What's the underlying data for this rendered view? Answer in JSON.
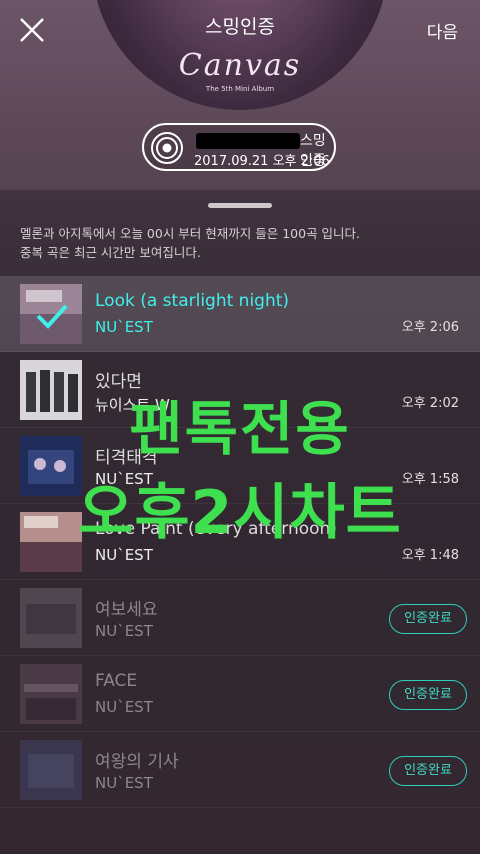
{
  "header": {
    "close_icon": "close-icon",
    "next_label": "다음",
    "album_title": "스밍인증",
    "album_logo": "Canvas",
    "album_subtitle": "The 5th Mini Album"
  },
  "stream_pill": {
    "icon": "vinyl-record-icon",
    "label": "스밍인증",
    "date": "2017.09.21 오후 2:06"
  },
  "info": {
    "line1": "멜론과 아지톡에서 오늘 00시 부터 현재까지 들은 100곡 입니다.",
    "line2": "중복 곡은 최근 시간만 보여집니다."
  },
  "songs": [
    {
      "title": "Look (a starlight night)",
      "artist": "NU`EST",
      "time": "오후 2:06"
    },
    {
      "title": "있다면",
      "artist": "뉴이스트 W",
      "time": "오후 2:02"
    },
    {
      "title": "티격태격",
      "artist": "NU`EST",
      "time": "오후 1:58"
    },
    {
      "title": "Love Paint (every afternoon)",
      "artist": "NU`EST",
      "time": "오후 1:48"
    },
    {
      "title": "여보세요",
      "artist": "NU`EST",
      "button": "인증완료"
    },
    {
      "title": "FACE",
      "artist": "NU`EST",
      "button": "인증완료"
    },
    {
      "title": "여왕의 기사",
      "artist": "NU`EST",
      "button": "인증완료"
    }
  ],
  "overlay": {
    "line1": "팬톡전용",
    "line2": "오후2시차트"
  },
  "colors": {
    "accent": "#3ff0ea",
    "done_border": "#2fcdbb",
    "overlay_text": "#3fe04f"
  }
}
